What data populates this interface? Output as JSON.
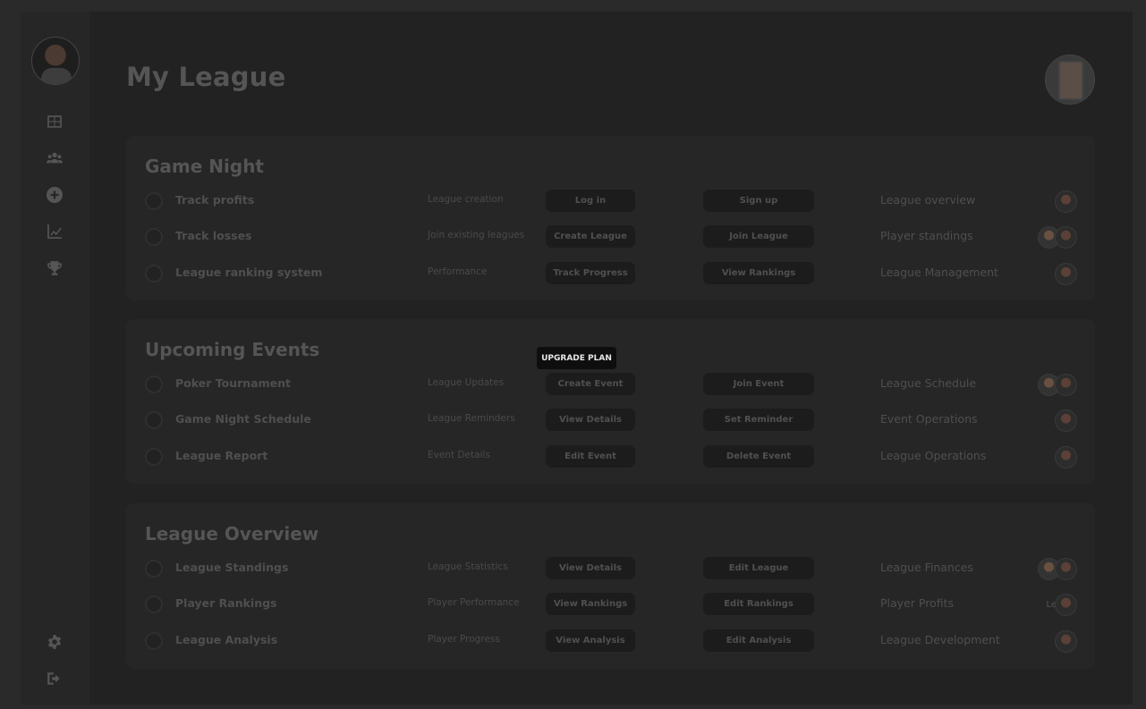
{
  "page": {
    "title": "My League"
  },
  "sidebar": {
    "icons": [
      "dashboard-icon",
      "users-icon",
      "plus-circle-icon",
      "chart-line-icon",
      "trophy-icon"
    ],
    "bottom_icons": [
      "gear-icon",
      "logout-icon"
    ]
  },
  "tooltip": "UPGRADE PLAN",
  "sections": [
    {
      "title": "Game Night",
      "rows": [
        {
          "task": "Track profits",
          "category": "League creation",
          "btn1": "Log in",
          "btn2": "Sign up",
          "area": "League overview",
          "avatars": 1
        },
        {
          "task": "Track losses",
          "category": "Join existing leagues",
          "btn1": "Create League",
          "btn2": "Join League",
          "area": "Player standings",
          "avatars": 2
        },
        {
          "task": "League ranking system",
          "category": "Performance",
          "btn1": "Track Progress",
          "btn2": "View Rankings",
          "area": "League Management",
          "avatars": 1
        }
      ]
    },
    {
      "title": "Upcoming Events",
      "rows": [
        {
          "task": "Poker Tournament",
          "category": "League Updates",
          "btn1": "Create Event",
          "btn2": "Join Event",
          "area": "League Schedule",
          "avatars": 2
        },
        {
          "task": "Game Night Schedule",
          "category": "League Reminders",
          "btn1": "View Details",
          "btn2": "Set Reminder",
          "area": "Event Operations",
          "avatars": 1
        },
        {
          "task": "League Report",
          "category": "Event Details",
          "btn1": "Edit Event",
          "btn2": "Delete Event",
          "area": "League Operations",
          "avatars": 1
        }
      ]
    },
    {
      "title": "League Overview",
      "rows": [
        {
          "task": "League Standings",
          "category": "League Statistics",
          "btn1": "View Details",
          "btn2": "Edit League",
          "area": "League Finances",
          "avatars": 2
        },
        {
          "task": "Player Rankings",
          "category": "Player Performance",
          "btn1": "View Rankings",
          "btn2": "Edit Rankings",
          "area": "Player Profits",
          "avatars": 1,
          "avatar_text": "Le"
        },
        {
          "task": "League Analysis",
          "category": "Player Progress",
          "btn1": "View Analysis",
          "btn2": "Edit Analysis",
          "area": "League Development",
          "avatars": 1
        }
      ]
    }
  ]
}
